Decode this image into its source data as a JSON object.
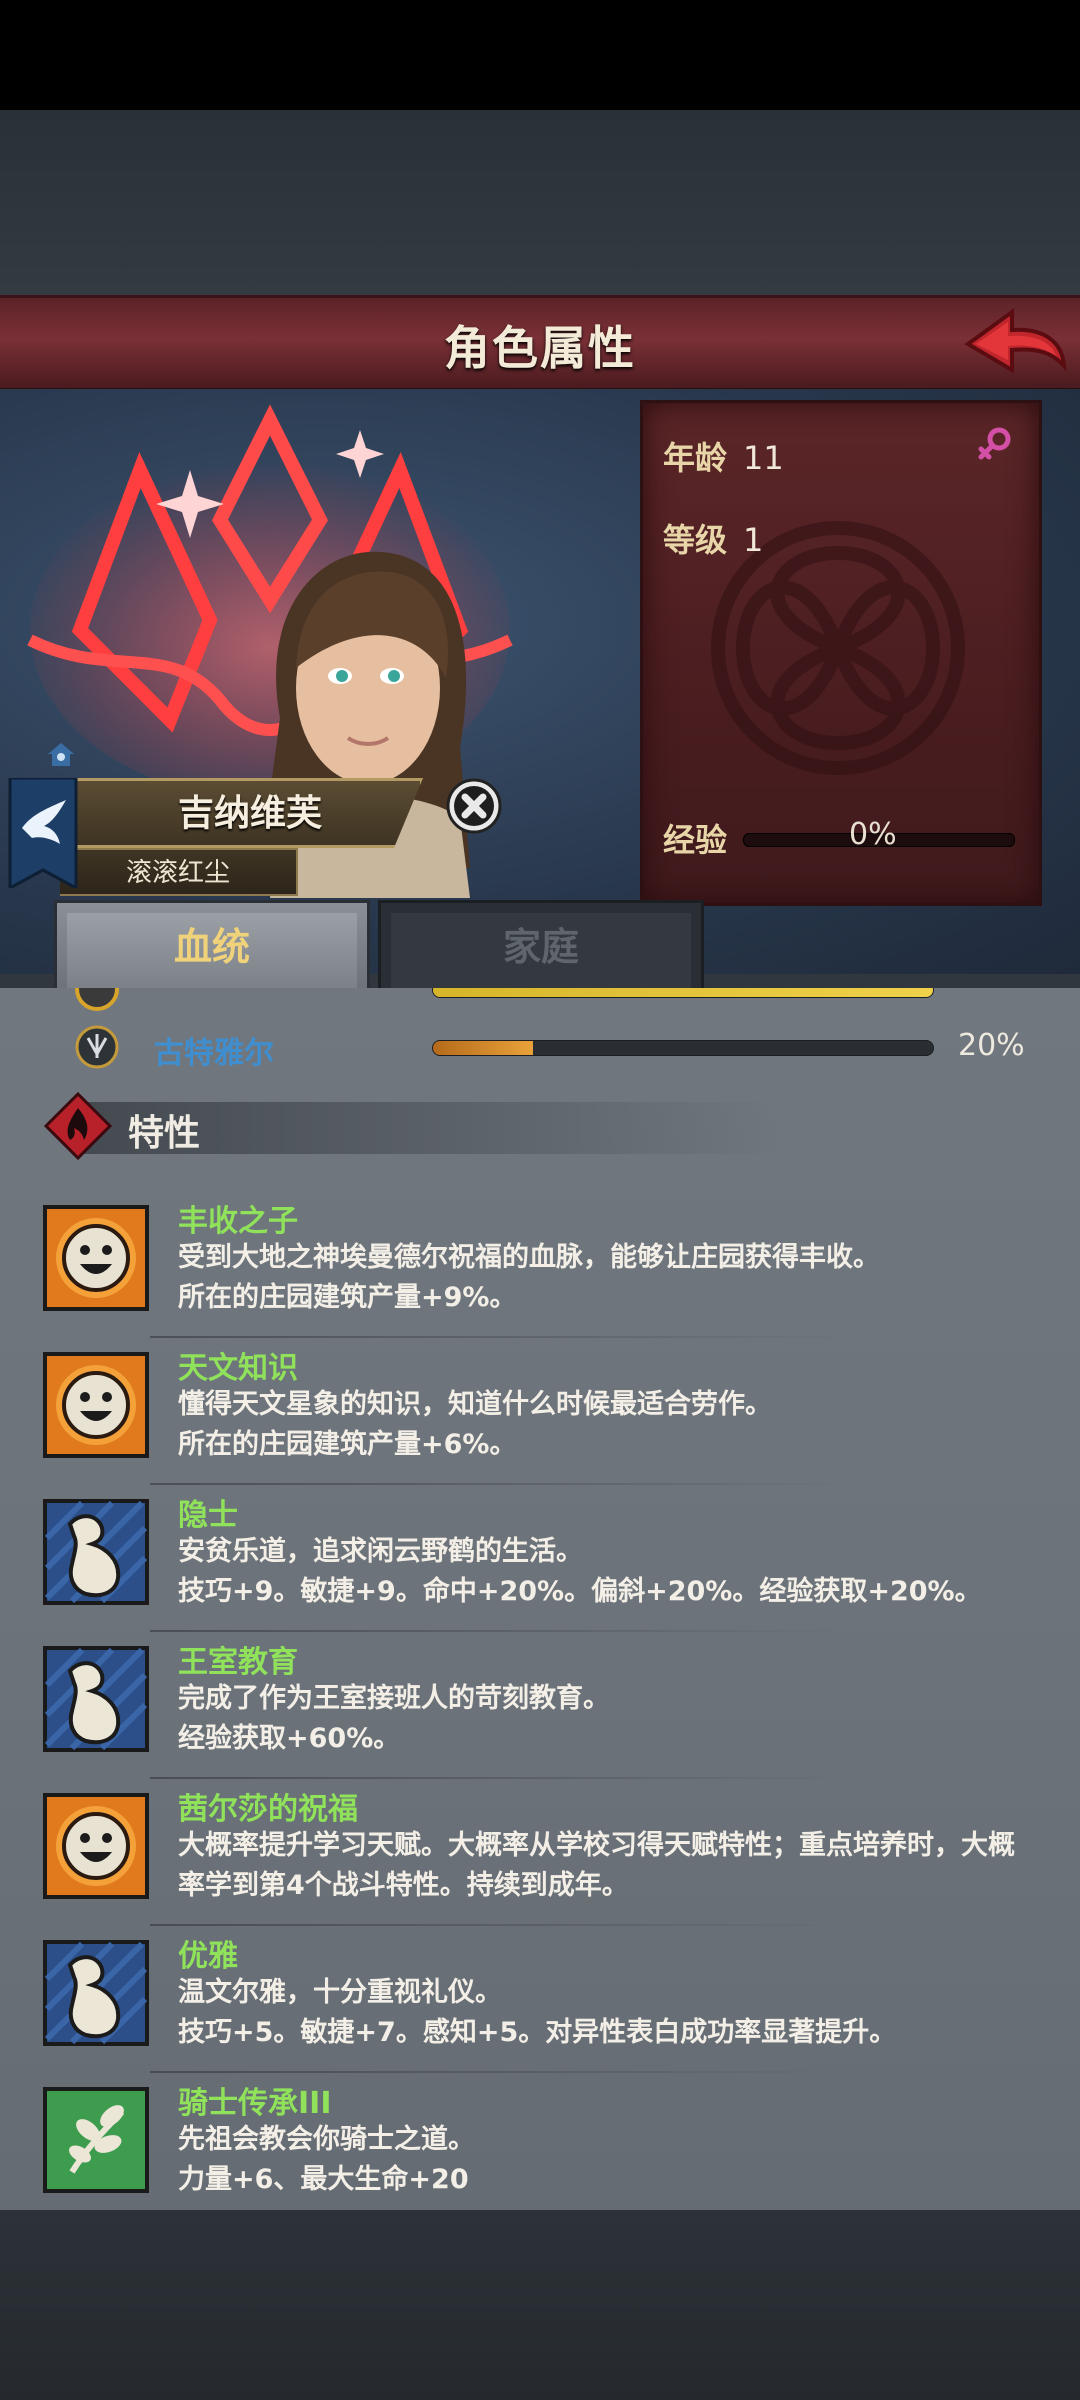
{
  "header": {
    "title": "角色属性"
  },
  "character": {
    "name": "吉纳维芙",
    "title": "滚滚红尘",
    "stats": {
      "age_label": "年龄",
      "age_value": "11",
      "level_label": "等级",
      "level_value": "1",
      "exp_label": "经验",
      "exp_value": "0%",
      "exp_fraction": 0
    },
    "gender": "female"
  },
  "tabs": [
    {
      "label": "血统",
      "active": true
    },
    {
      "label": "家庭",
      "active": false
    }
  ],
  "lineage": [
    {
      "name": "古特雅尔",
      "percent": "20%",
      "fraction": 0.2,
      "color": "#e9a23a"
    }
  ],
  "traits_section": {
    "title": "特性"
  },
  "traits": [
    {
      "name": "丰收之子",
      "icon": "smile-sun-icon",
      "desc": "受到大地之神埃曼德尔祝福的血脉，能够让庄园获得丰收。\n所在的庄园建筑产量+9%。"
    },
    {
      "name": "天文知识",
      "icon": "smile-sun-icon",
      "desc": "懂得天文星象的知识，知道什么时候最适合劳作。\n所在的庄园建筑产量+6%。"
    },
    {
      "name": "隐士",
      "icon": "flex-arm-icon",
      "desc": "安贫乐道，追求闲云野鹤的生活。\n技巧+9。敏捷+9。命中+20%。偏斜+20%。经验获取+20%。"
    },
    {
      "name": "王室教育",
      "icon": "flex-arm-icon",
      "desc": "完成了作为王室接班人的苛刻教育。\n经验获取+60%。"
    },
    {
      "name": "茜尔莎的祝福",
      "icon": "smile-sun-icon",
      "desc": "大概率提升学习天赋。大概率从学校习得天赋特性；重点培养时，大概\n率学到第4个战斗特性。持续到成年。"
    },
    {
      "name": "优雅",
      "icon": "flex-arm-icon",
      "desc": "温文尔雅，十分重视礼仪。\n技巧+5。敏捷+7。感知+5。对异性表白成功率显著提升。"
    },
    {
      "name": "骑士传承III",
      "icon": "leaf-branch-icon",
      "desc": "先祖会教会你骑士之道。\n力量+6、最大生命+20"
    }
  ],
  "colors": {
    "trait_name": "#8fe25a",
    "lineage_name": "#3f8fd0",
    "header_bg": "#7a3036",
    "active_tab_text": "#f0d27a"
  }
}
